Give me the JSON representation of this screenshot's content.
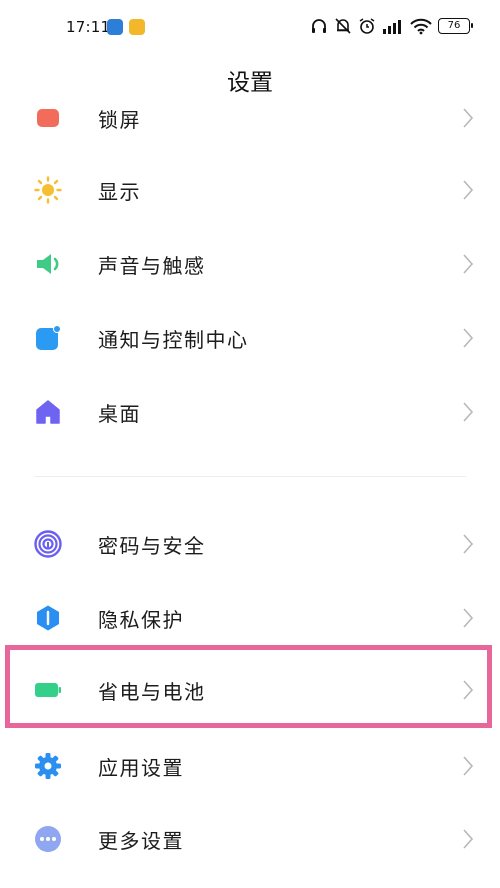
{
  "status_bar": {
    "time": "17:11",
    "battery": "76"
  },
  "header": {
    "title": "设置"
  },
  "items": [
    {
      "label": "锁屏",
      "icon": "lock-screen-icon",
      "color": "#f26b5b"
    },
    {
      "label": "显示",
      "icon": "sun-icon",
      "color": "#f7be34"
    },
    {
      "label": "声音与触感",
      "icon": "speaker-icon",
      "color": "#3ecb86"
    },
    {
      "label": "通知与控制中心",
      "icon": "notification-icon",
      "color": "#2b9af3"
    },
    {
      "label": "桌面",
      "icon": "home-icon",
      "color": "#6f63f2"
    },
    {
      "label": "密码与安全",
      "icon": "fingerprint-icon",
      "color": "#6a5ff0"
    },
    {
      "label": "隐私保护",
      "icon": "privacy-shield-icon",
      "color": "#2a8ff0"
    },
    {
      "label": "省电与电池",
      "icon": "battery-icon",
      "color": "#34d08a"
    },
    {
      "label": "应用设置",
      "icon": "gear-icon",
      "color": "#2a8ff0"
    },
    {
      "label": "更多设置",
      "icon": "more-icon",
      "color": "#8fa6f0"
    }
  ]
}
